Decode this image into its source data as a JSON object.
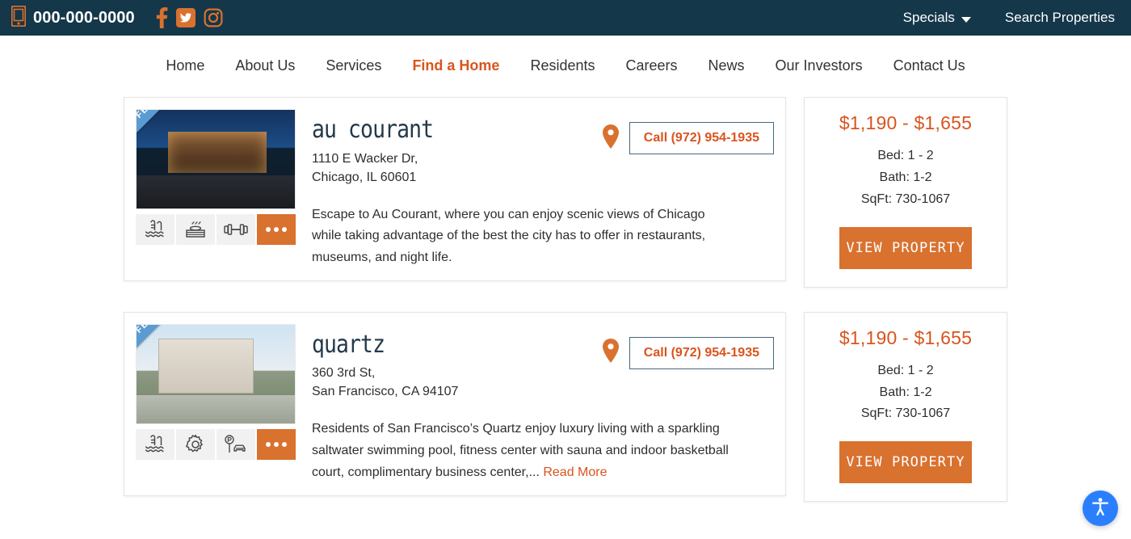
{
  "topbar": {
    "phone": "000-000-0000",
    "phone_icon": "mobile-phone-icon",
    "social": [
      {
        "name": "facebook-icon",
        "label": "Facebook"
      },
      {
        "name": "twitter-icon",
        "label": "Twitter"
      },
      {
        "name": "instagram-icon",
        "label": "Instagram"
      }
    ],
    "specials_label": "Specials",
    "search_label": "Search Properties",
    "background_color": "#14374a",
    "accent_color": "#d9712f"
  },
  "nav": {
    "items": [
      {
        "label": "Home",
        "active": false
      },
      {
        "label": "About Us",
        "active": false
      },
      {
        "label": "Services",
        "active": false
      },
      {
        "label": "Find a Home",
        "active": true
      },
      {
        "label": "Residents",
        "active": false
      },
      {
        "label": "Careers",
        "active": false
      },
      {
        "label": "News",
        "active": false
      },
      {
        "label": "Our Investors",
        "active": false
      },
      {
        "label": "Contact Us",
        "active": false
      }
    ],
    "active_color": "#d9541e"
  },
  "listings": [
    {
      "ribbon": "FEATURED",
      "title": "Au Courant",
      "address_line1": "1110 E Wacker Dr,",
      "address_line2": "Chicago, IL 60601",
      "call_label": "Call (972) 954-1935",
      "pin_icon": "map-pin-icon",
      "description": "Escape to Au Courant, where you can enjoy scenic views of Chicago while taking advantage of the best the city has to offer in restaurants, museums, and night life.",
      "read_more": "",
      "amenities": [
        {
          "icon": "swimming-pool-icon",
          "label": "Swimming Pool"
        },
        {
          "icon": "sauna-icon",
          "label": "Sauna"
        },
        {
          "icon": "fitness-dumbbell-icon",
          "label": "Fitness Center"
        },
        {
          "icon": "more-options-icon",
          "label": "More"
        }
      ],
      "price_range": "$1,190 - $1,655",
      "bed": "Bed: 1 - 2",
      "bath": "Bath: 1-2",
      "sqft": "SqFt: 730-1067",
      "view_label": "View Property"
    },
    {
      "ribbon": "FEATURED",
      "title": "Quartz",
      "address_line1": "360 3rd St,",
      "address_line2": "San Francisco, CA 94107",
      "call_label": "Call (972) 954-1935",
      "pin_icon": "map-pin-icon",
      "description": "Residents of San Francisco’s Quartz enjoy luxury living with a sparkling saltwater swimming pool, fitness center with sauna and indoor basketball court, complimentary business center,... ",
      "read_more": "Read More",
      "amenities": [
        {
          "icon": "swimming-pool-icon",
          "label": "Swimming Pool"
        },
        {
          "icon": "gear-icon",
          "label": "Services"
        },
        {
          "icon": "parking-icon",
          "label": "Parking"
        },
        {
          "icon": "more-options-icon",
          "label": "More"
        }
      ],
      "price_range": "$1,190 - $1,655",
      "bed": "Bed: 1 - 2",
      "bath": "Bath: 1-2",
      "sqft": "SqFt: 730-1067",
      "view_label": "View Property"
    }
  ],
  "accessibility": {
    "icon": "accessibility-person-icon",
    "label": "Accessibility Options",
    "color": "#2b7fff"
  }
}
